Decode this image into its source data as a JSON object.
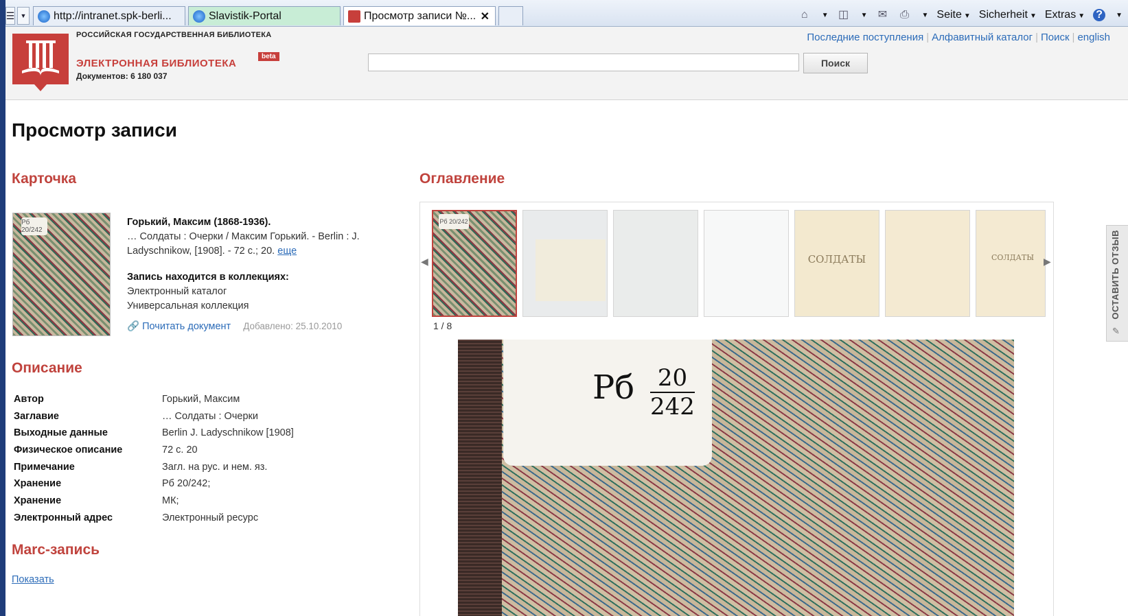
{
  "browser": {
    "tabs": [
      {
        "label": "http://intranet.spk-berli...",
        "style": "normal"
      },
      {
        "label": "Slavistik-Portal",
        "style": "green"
      },
      {
        "label": "Просмотр записи №...",
        "style": "active"
      }
    ],
    "toolbar": {
      "page_menu": "Seite",
      "security_menu": "Sicherheit",
      "extras_menu": "Extras"
    }
  },
  "site": {
    "org_name": "РОССИЙСКАЯ ГОСУДАРСТВЕННАЯ БИБЛИОТЕКА",
    "library_title": "ЭЛЕКТРОННАЯ БИБЛИОТЕКА",
    "beta_badge": "beta",
    "document_count": "Документов: 6 180 037",
    "nav": {
      "recent": "Последние поступления",
      "alphabetical": "Алфавитный каталог",
      "search": "Поиск",
      "english": "english"
    },
    "search": {
      "value": "",
      "button": "Поиск"
    }
  },
  "page": {
    "title": "Просмотр записи",
    "card_heading": "Карточка",
    "contents_heading": "Оглавление",
    "description_heading": "Описание",
    "marc_heading": "Marc-запись",
    "marc_show": "Показать"
  },
  "card": {
    "thumb_label": "Рб 20/242",
    "author": "Горький, Максим (1868-1936).",
    "bib_line": "… Солдаты : Очерки / Максим Горький. - Berlin : J. Ladyschnikow, [1908]. - 72 с.; 20.",
    "more": "еще",
    "collections_title": "Запись находится в коллекциях:",
    "collections": [
      "Электронный каталог",
      "Универсальная коллекция"
    ],
    "read_link": "Почитать документ",
    "added": "Добавлено: 25.10.2010"
  },
  "description": [
    {
      "key": "Автор",
      "value": "Горький, Максим"
    },
    {
      "key": "Заглавие",
      "value": "… Солдаты : Очерки"
    },
    {
      "key": "Выходные данные",
      "value": "Berlin J. Ladyschnikow [1908]"
    },
    {
      "key": "Физическое описание",
      "value": "72 с. 20"
    },
    {
      "key": "Примечание",
      "value": "Загл. на рус. и нем. яз."
    },
    {
      "key": "Хранение",
      "value": "Рб 20/242;"
    },
    {
      "key": "Хранение",
      "value": "МК;"
    },
    {
      "key": "Электронный адрес",
      "value": "Электронный ресурс"
    }
  ],
  "viewer": {
    "pager": "1 / 8",
    "thumbs": [
      {
        "kind": "cover",
        "caption": "Рб 20/242"
      },
      {
        "kind": "blank-inset",
        "caption": ""
      },
      {
        "kind": "blank",
        "caption": ""
      },
      {
        "kind": "white",
        "caption": ""
      },
      {
        "kind": "title",
        "caption": "СОЛДАТЫ"
      },
      {
        "kind": "plain",
        "caption": ""
      },
      {
        "kind": "title-small",
        "caption": "СОЛДАТЫ"
      }
    ],
    "main_label_text": "Рб",
    "main_label_top": "20",
    "main_label_bottom": "242"
  },
  "feedback_tab": "ОСТАВИТЬ ОТЗЫВ"
}
